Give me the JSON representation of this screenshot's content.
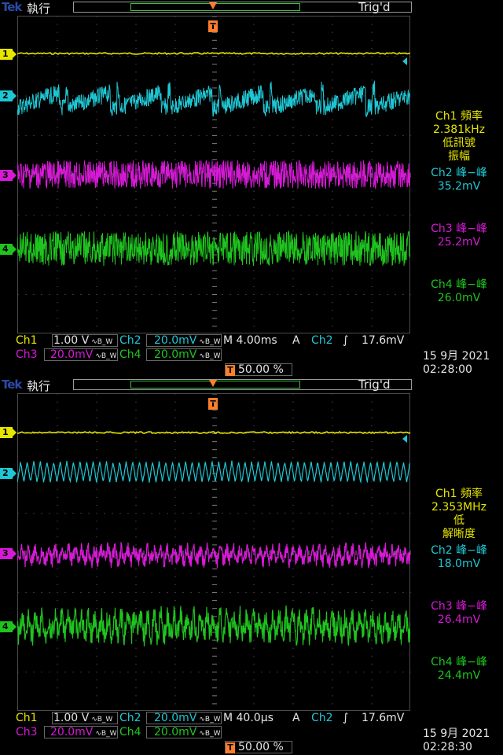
{
  "screens": [
    {
      "brand": "Tek",
      "run_state": "執行",
      "trigger_state": "Trig'd",
      "trigger_marker": "T",
      "channel_markers": [
        "1",
        "2",
        "3",
        "4"
      ],
      "measurements": {
        "ch1_label": "Ch1 頻率",
        "ch1_value": "2.381kHz",
        "ch1_note1": "低訊號",
        "ch1_note2": "振幅",
        "ch2_label": "Ch2 峰−峰",
        "ch2_value": "35.2mV",
        "ch3_label": "Ch3 峰−峰",
        "ch3_value": "25.2mV",
        "ch4_label": "Ch4 峰−峰",
        "ch4_value": "26.0mV"
      },
      "readout": {
        "ch1": "Ch1",
        "ch1_scale": "1.00 V",
        "ch2": "Ch2",
        "ch2_scale": "20.0mV",
        "ch3": "Ch3",
        "ch3_scale": "20.0mV",
        "ch4": "Ch4",
        "ch4_scale": "20.0mV",
        "bw": "∿B_W",
        "timebase": "M 4.00ms",
        "acq": "A",
        "trig_src": "Ch2",
        "trig_slope": "∫",
        "trig_level": "17.6mV",
        "position": "50.00 %",
        "pos_marker": "T",
        "date": "15 9月  2021",
        "time": "02:28:00"
      }
    },
    {
      "brand": "Tek",
      "run_state": "執行",
      "trigger_state": "Trig'd",
      "trigger_marker": "T",
      "channel_markers": [
        "1",
        "2",
        "3",
        "4"
      ],
      "measurements": {
        "ch1_label": "Ch1 頻率",
        "ch1_value": "2.353MHz",
        "ch1_note1": "低",
        "ch1_note2": "解晰度",
        "ch2_label": "Ch2 峰−峰",
        "ch2_value": "18.0mV",
        "ch3_label": "Ch3 峰−峰",
        "ch3_value": "26.4mV",
        "ch4_label": "Ch4 峰−峰",
        "ch4_value": "24.4mV"
      },
      "readout": {
        "ch1": "Ch1",
        "ch1_scale": "1.00 V",
        "ch2": "Ch2",
        "ch2_scale": "20.0mV",
        "ch3": "Ch3",
        "ch3_scale": "20.0mV",
        "ch4": "Ch4",
        "ch4_scale": "20.0mV",
        "bw": "∿B_W",
        "timebase": "M 40.0µs",
        "acq": "A",
        "trig_src": "Ch2",
        "trig_slope": "∫",
        "trig_level": "17.6mV",
        "position": "50.00 %",
        "pos_marker": "T",
        "date": "15 9月  2021",
        "time": "02:28:30"
      }
    }
  ],
  "colors": {
    "ch1": "#e6e600",
    "ch2": "#1fc7d4",
    "ch3": "#d61ad6",
    "ch4": "#1fc41f",
    "trigger": "#ff7e2a"
  }
}
